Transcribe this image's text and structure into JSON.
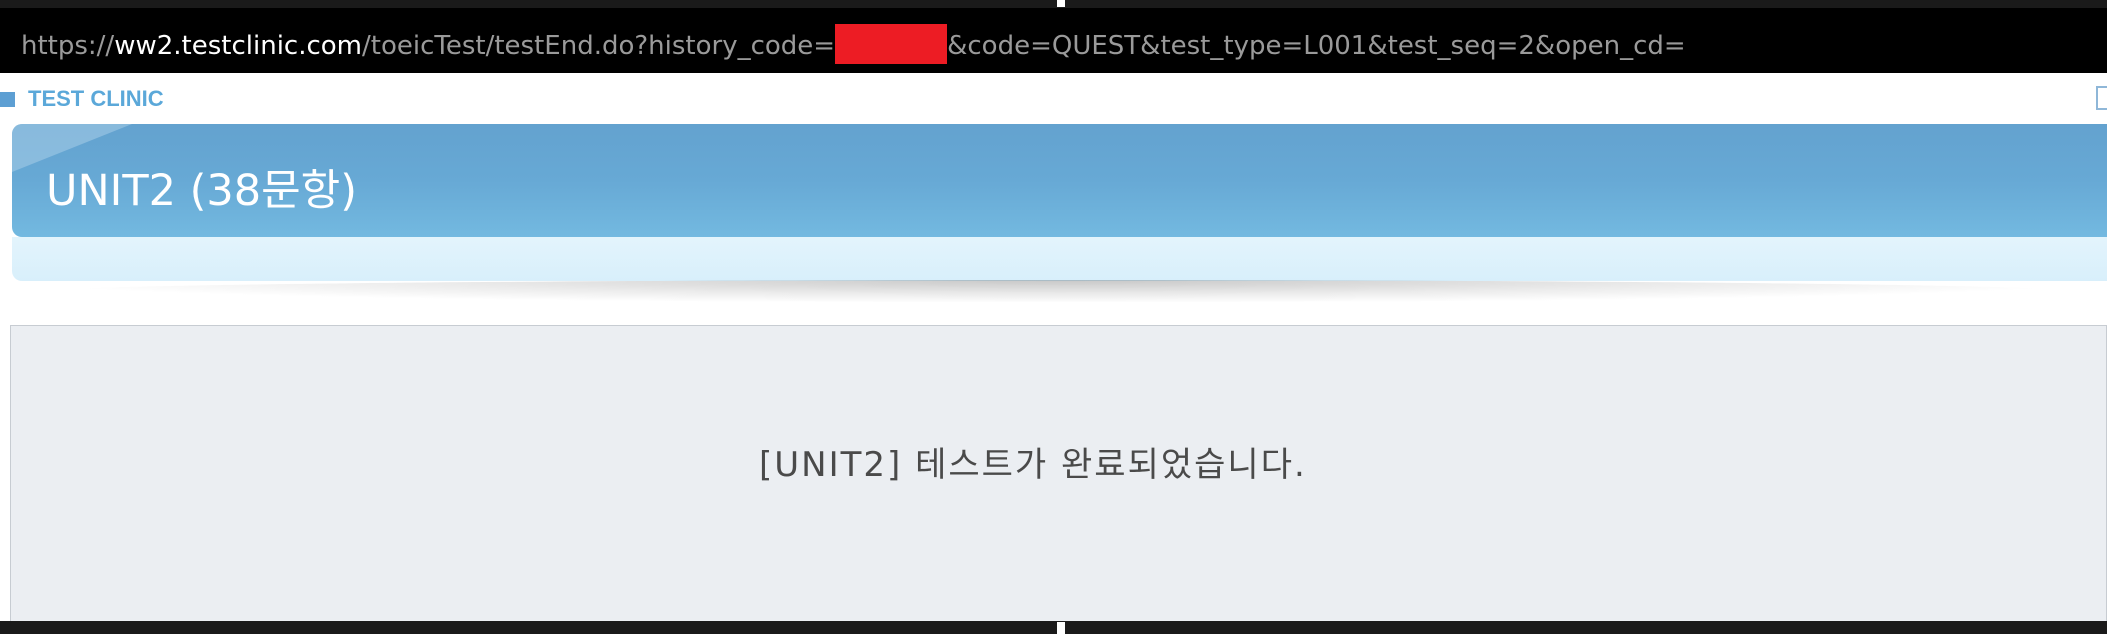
{
  "address_bar": {
    "scheme": "https://",
    "host": "ww2.testclinic.com",
    "path_prefix": "/toeicTest/testEnd.do?history_code=",
    "path_suffix": "&code=QUEST&test_type=L001&test_seq=2&open_cd=",
    "redaction_color": "#ed1c24"
  },
  "brand": {
    "name": "TEST CLINIC",
    "color": "#5ba8d9"
  },
  "header": {
    "title": "UNIT2 (38문항)",
    "accent_color": "#67a9d5"
  },
  "content": {
    "message": "[UNIT2] 테스트가 완료되었습니다."
  },
  "icons": {
    "brand_marker": "square-bullet-icon",
    "close": "close-icon"
  }
}
